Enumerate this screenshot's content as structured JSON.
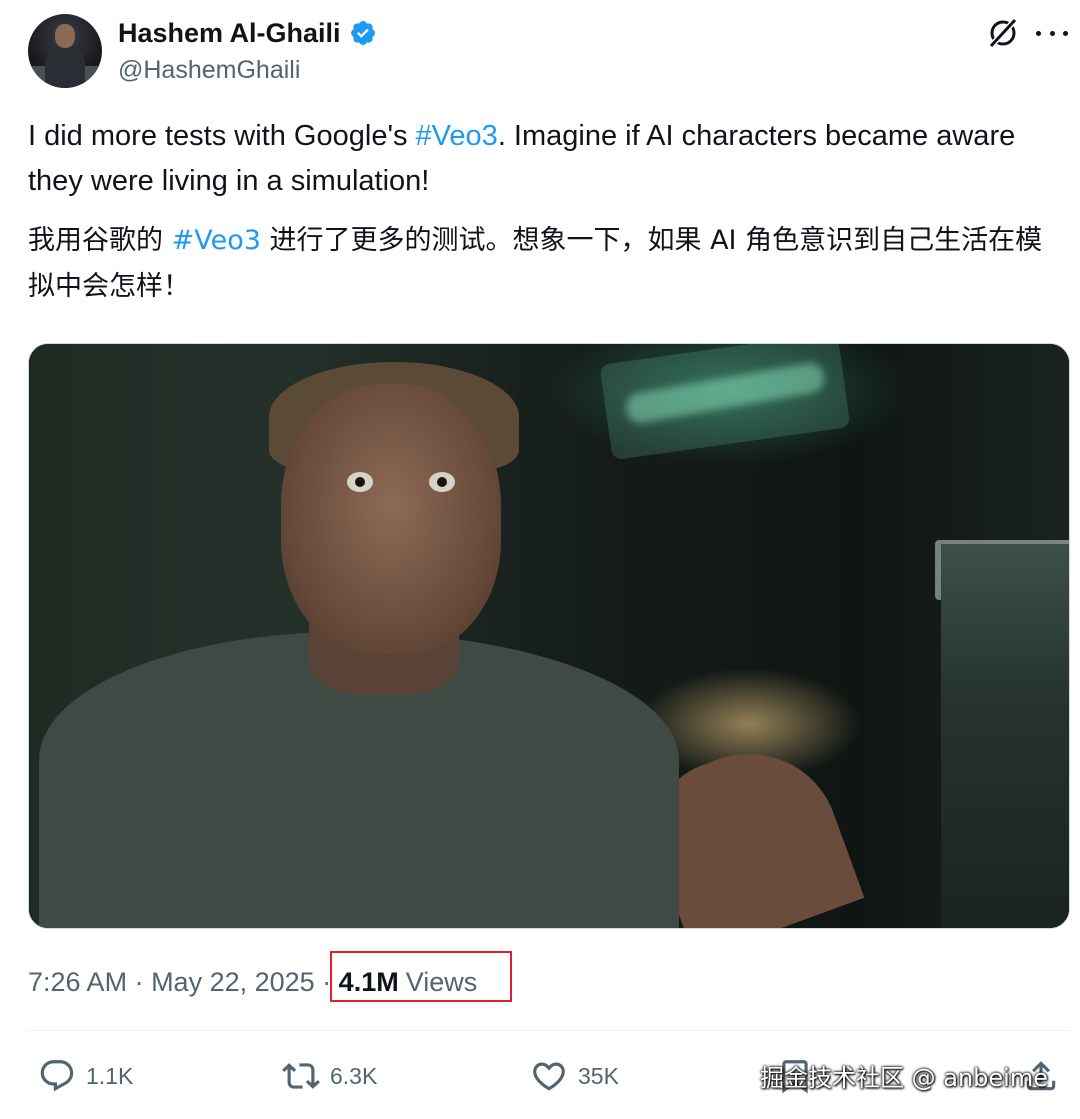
{
  "author": {
    "name": "Hashem Al-Ghaili",
    "handle": "@HashemGhaili",
    "verified": true
  },
  "header_icons": [
    "grok-icon",
    "more-options-icon"
  ],
  "post": {
    "text_en": {
      "before": "I did more tests with Google's ",
      "hashtag": "#Veo3",
      "after": ". Imagine if AI characters became aware they were living in a simulation!"
    },
    "text_zh": {
      "before": "我用谷歌的 ",
      "hashtag": "#Veo3",
      "after": " 进行了更多的测试。想象一下，如果 AI 角色意识到自己生活在模拟中会怎样！"
    }
  },
  "meta": {
    "time": "7:26 AM",
    "separator": " · ",
    "date": "May 22, 2025",
    "views_count": "4.1M",
    "views_label": "Views"
  },
  "actions": {
    "reply_count": "1.1K",
    "retweet_count": "6.3K",
    "like_count": "35K"
  },
  "watermark": "掘金技术社区 @ anbeime",
  "colors": {
    "accent": "#1d9bf0",
    "secondary_text": "#536471",
    "highlight_box": "#e0202e"
  }
}
